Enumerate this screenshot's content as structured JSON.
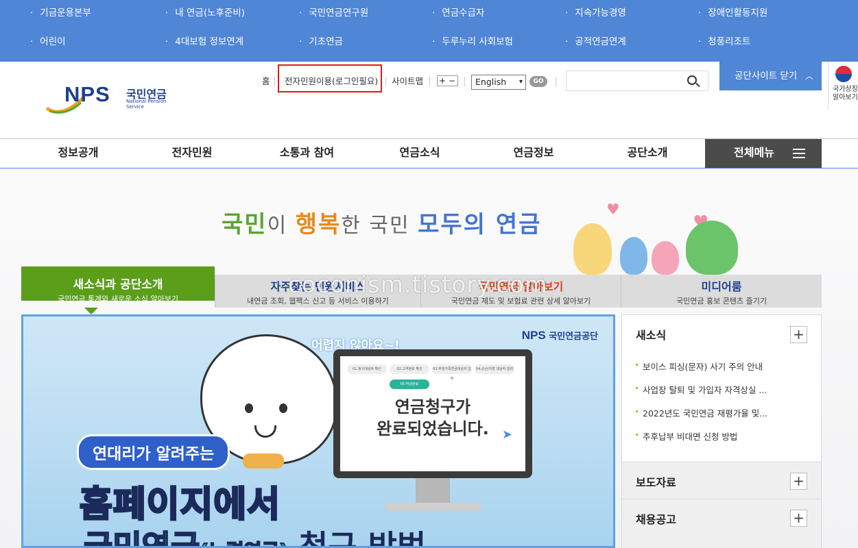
{
  "family_sites": [
    "기금운용본부",
    "내 연금(노후준비)",
    "국민연금연구원",
    "연금수급자",
    "지속가능경영",
    "장애인활동지원",
    "어린이",
    "4대보험 정보연계",
    "기초연금",
    "두루누리 사회보험",
    "공적연금연계",
    "청풍리조트"
  ],
  "logo": {
    "brand": "NPS",
    "name_kr": "국민연금",
    "name_en": "National Pension Service"
  },
  "util": {
    "home": "홈",
    "login": "전자민원이용(로그인필요)",
    "sitemap": "사이트맵",
    "zoom_in": "+",
    "zoom_out": "−",
    "language": "English",
    "go": "GO",
    "close_site": "공단사이트 닫기",
    "flag_label_1": "국가상징",
    "flag_label_2": "알아보기"
  },
  "colors": {
    "accent_blue": "#4f86d6",
    "tab_green": "#5a9e1a",
    "login_highlight": "#e01919"
  },
  "gnb": {
    "items": [
      "정보공개",
      "전자민원",
      "소통과 참여",
      "연금소식",
      "연금정보",
      "공단소개"
    ],
    "all_menu": "전체메뉴"
  },
  "hero": {
    "slogan_1": "국민",
    "slogan_2": "이 ",
    "slogan_3": "행복",
    "slogan_4": "한 국민 ",
    "slogan_5": "모두의 연금"
  },
  "tabs": [
    {
      "title": "새소식과 공단소개",
      "sub": "국민연금 통계와 새로운 소식 알아보기"
    },
    {
      "title": "자주찾는 민원서비스",
      "sub": "내연금 조회, 웹팩스 신고 등 서비스 이용하기"
    },
    {
      "title": "국민연금 알아보기",
      "sub": "국민연금 제도 및 보험료 관련 상세 알아보기"
    },
    {
      "title": "미디어룸",
      "sub": "국민연금 홍보 콘텐츠 즐기기"
    }
  ],
  "banner": {
    "logo_brand": "NPS",
    "logo_name": "국민연금공단",
    "bubble": "어렵지 않아요~!",
    "steps": [
      "01.청구대상자 확인",
      "02.고객정보 확인",
      "03.부양가족연금대상자 입력",
      "04.손산/지방 대상자 입력"
    ],
    "step_done": "05.작성완료",
    "screen_msg_1": "연금청구가",
    "screen_msg_2": "완료되었습니다.",
    "pill": "연대리가 알려주는",
    "headline_1": "홈페이지에서",
    "headline_2a": "국민연금",
    "headline_2b": "(노령연금)",
    "headline_2c": " 청구 방법"
  },
  "news": {
    "title": "새소식",
    "items": [
      "보이스 피싱(문자) 사기 주의 안내",
      "사업장 탈퇴 및 가입자 자격상실 ...",
      "2022년도 국민연금 재평가율 및...",
      "추후납부 비대면 신청 방법"
    ],
    "press": "보도자료",
    "jobs": "채용공고",
    "plus": "+"
  },
  "watermark": "coconism.tistory.com"
}
